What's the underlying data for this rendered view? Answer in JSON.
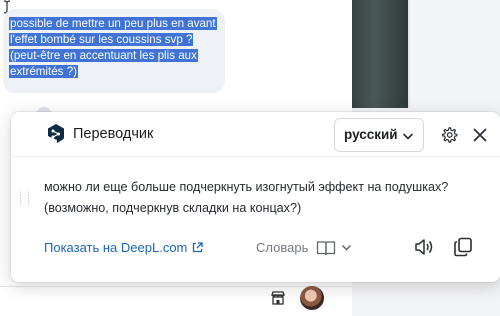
{
  "chat": {
    "message_text": "possible de mettre un peu plus en avant l'effet bombé sur les coussins svp ? (peut-être en accentuant les plis aux extrémités ?)"
  },
  "translator": {
    "title": "Переводчик",
    "target_language": "русский",
    "translation": "можно ли еще больше подчеркнуть изогнутый эффект на подушках? (возможно, подчеркнув складки на концах?)",
    "show_on_site_link": "Показать на DeepL.com",
    "dictionary_label": "Словарь",
    "icons": {
      "logo": "deepl-logo-icon",
      "chevron": "chevron-down-icon",
      "settings": "gear-icon",
      "close": "close-icon",
      "external": "external-link-icon",
      "dictionary": "book-icon",
      "speaker": "speaker-icon",
      "copy": "copy-icon"
    },
    "colors": {
      "link": "#1a67b5",
      "logo": "#0f2b46"
    }
  },
  "colors": {
    "selection": "#3f74d6",
    "bubble": "#eef1f5"
  }
}
